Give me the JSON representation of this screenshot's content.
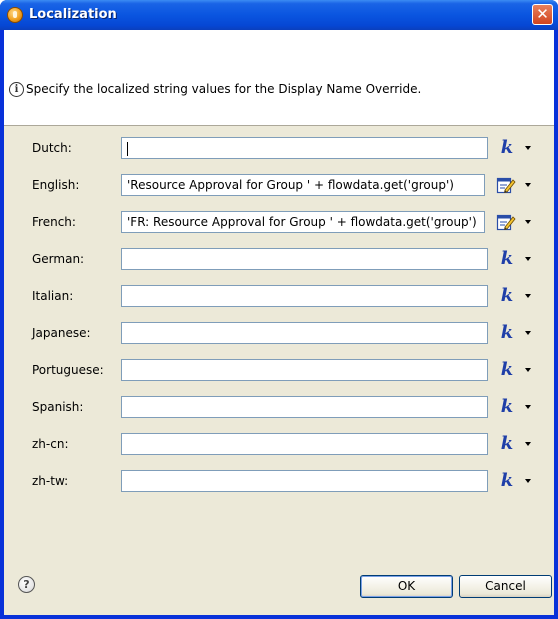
{
  "window": {
    "title": "Localization",
    "close_symbol": "✕"
  },
  "header": {
    "info_icon_glyph": "i",
    "message": "Specify the localized string values for the Display Name Override."
  },
  "rows": [
    {
      "label": "Dutch:",
      "value": "",
      "focused": true,
      "icon": "k-icon"
    },
    {
      "label": "English:",
      "value": "'Resource Approval for Group ' + flowdata.get('group')",
      "focused": false,
      "icon": "edit-expression-icon"
    },
    {
      "label": "French:",
      "value": "'FR: Resource Approval for Group ' + flowdata.get('group')",
      "focused": false,
      "icon": "edit-expression-icon"
    },
    {
      "label": "German:",
      "value": "",
      "focused": false,
      "icon": "k-icon"
    },
    {
      "label": "Italian:",
      "value": "",
      "focused": false,
      "icon": "k-icon"
    },
    {
      "label": "Japanese:",
      "value": "",
      "focused": false,
      "icon": "k-icon"
    },
    {
      "label": "Portuguese:",
      "value": "",
      "focused": false,
      "icon": "k-icon"
    },
    {
      "label": "Spanish:",
      "value": "",
      "focused": false,
      "icon": "k-icon"
    },
    {
      "label": "zh-cn:",
      "value": "",
      "focused": false,
      "icon": "k-icon"
    },
    {
      "label": "zh-tw:",
      "value": "",
      "focused": false,
      "icon": "k-icon"
    }
  ],
  "k_glyph": "k",
  "footer": {
    "help_glyph": "?",
    "ok_label": "OK",
    "cancel_label": "Cancel"
  }
}
